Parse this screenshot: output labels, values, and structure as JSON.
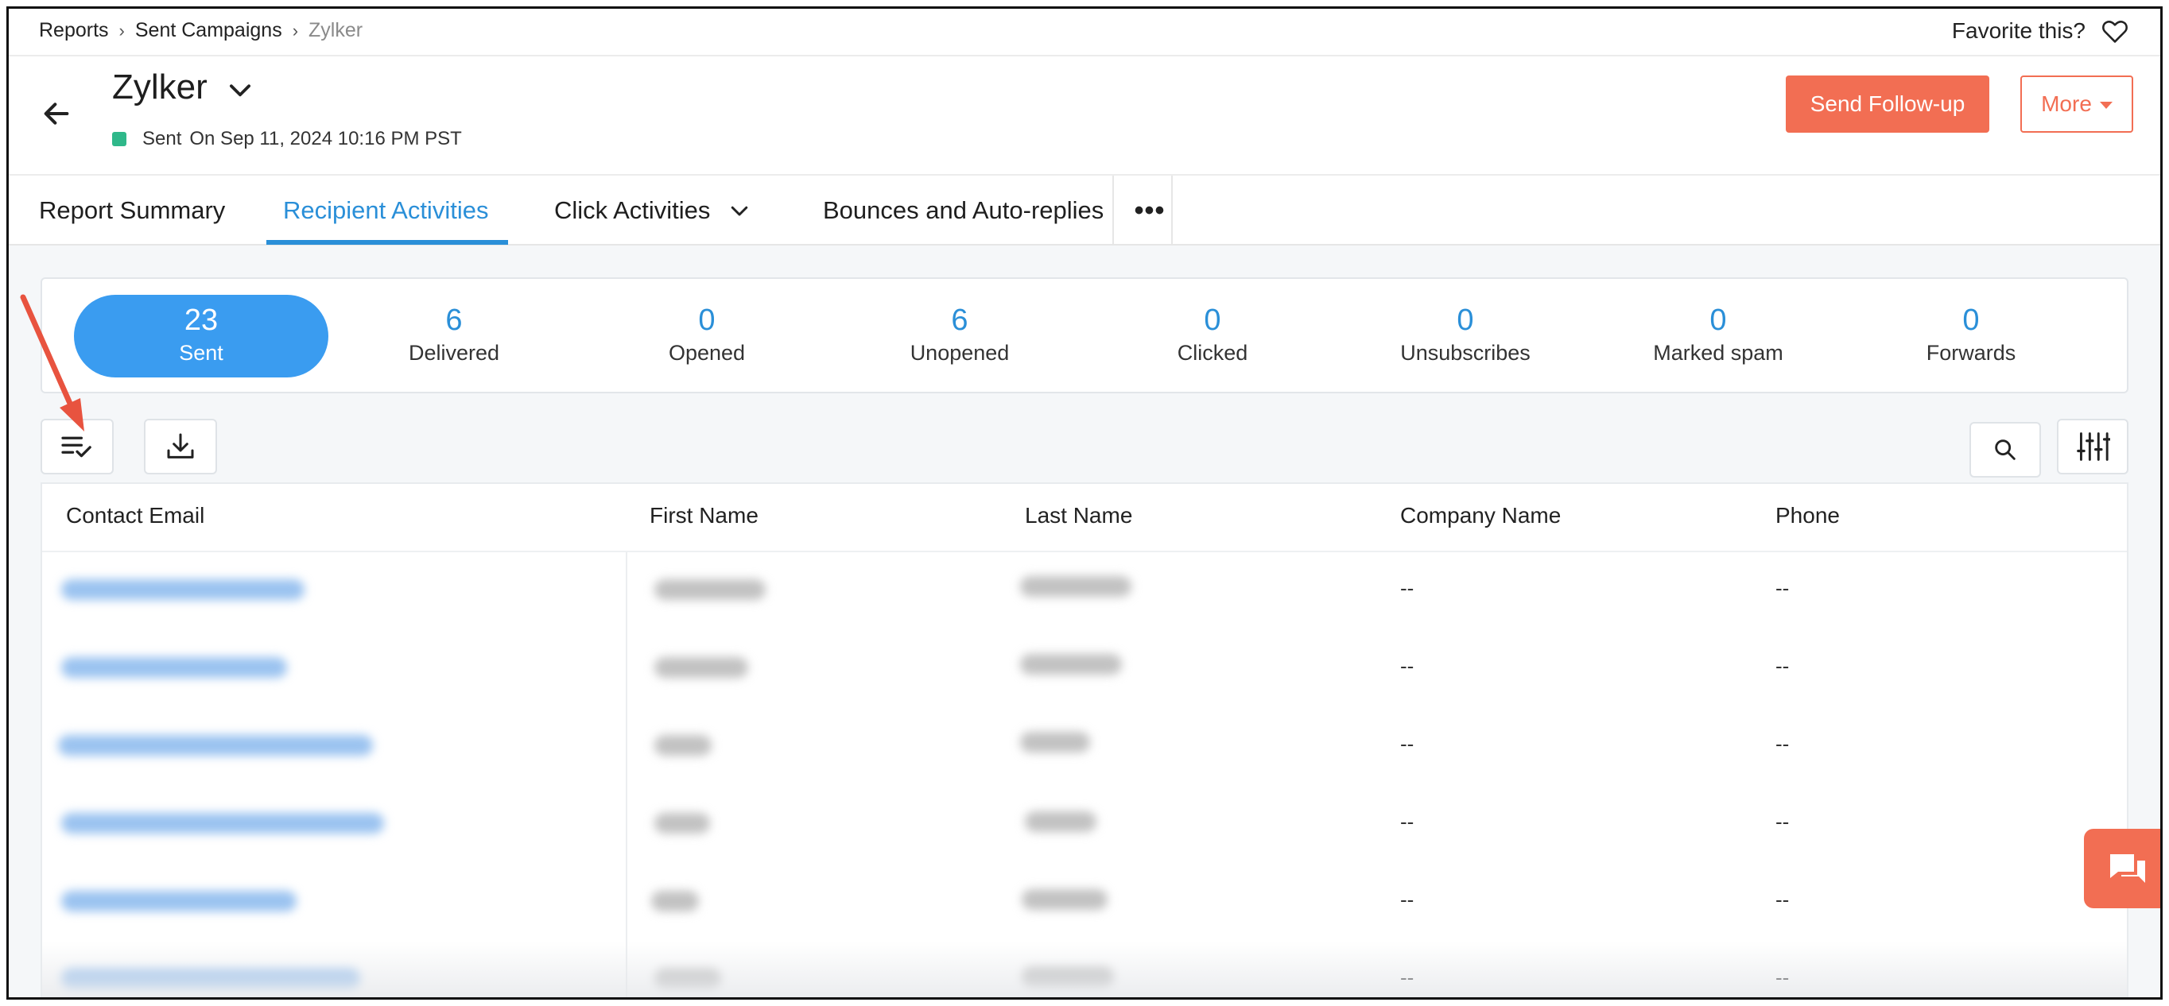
{
  "breadcrumb": {
    "items": [
      "Reports",
      "Sent Campaigns"
    ],
    "current": "Zylker"
  },
  "favorite": {
    "label": "Favorite this?"
  },
  "campaign": {
    "title": "Zylker",
    "status": "Sent",
    "sent_on": "On Sep 11, 2024 10:16 PM PST",
    "status_color": "#2fb88a"
  },
  "actions": {
    "follow_up": "Send Follow-up",
    "more": "More"
  },
  "tabs": [
    {
      "label": "Report Summary",
      "active": false
    },
    {
      "label": "Recipient Activities",
      "active": true
    },
    {
      "label": "Click Activities",
      "active": false
    },
    {
      "label": "Bounces and Auto-replies",
      "active": false
    }
  ],
  "stats": [
    {
      "value": "23",
      "label": "Sent",
      "active": true
    },
    {
      "value": "6",
      "label": "Delivered"
    },
    {
      "value": "0",
      "label": "Opened"
    },
    {
      "value": "6",
      "label": "Unopened"
    },
    {
      "value": "0",
      "label": "Clicked"
    },
    {
      "value": "0",
      "label": "Unsubscribes"
    },
    {
      "value": "0",
      "label": "Marked spam"
    },
    {
      "value": "0",
      "label": "Forwards"
    }
  ],
  "table": {
    "columns": [
      "Contact Email",
      "First Name",
      "Last Name",
      "Company Name",
      "Phone"
    ],
    "rows": [
      {
        "company": "--",
        "phone": "--"
      },
      {
        "company": "--",
        "phone": "--"
      },
      {
        "company": "--",
        "phone": "--"
      },
      {
        "company": "--",
        "phone": "--"
      },
      {
        "company": "--",
        "phone": "--"
      },
      {
        "company": "--",
        "phone": "--"
      }
    ]
  },
  "colors": {
    "accent": "#2a8fd8",
    "brand": "#f26e53",
    "pill": "#3a9cf0",
    "annotation": "#e8533f"
  },
  "icons": {
    "back": "arrow-left-icon",
    "favorite": "heart-icon",
    "select_columns": "list-check-icon",
    "export": "download-icon",
    "search": "search-icon",
    "filter": "sliders-icon",
    "chat": "chat-icon"
  }
}
